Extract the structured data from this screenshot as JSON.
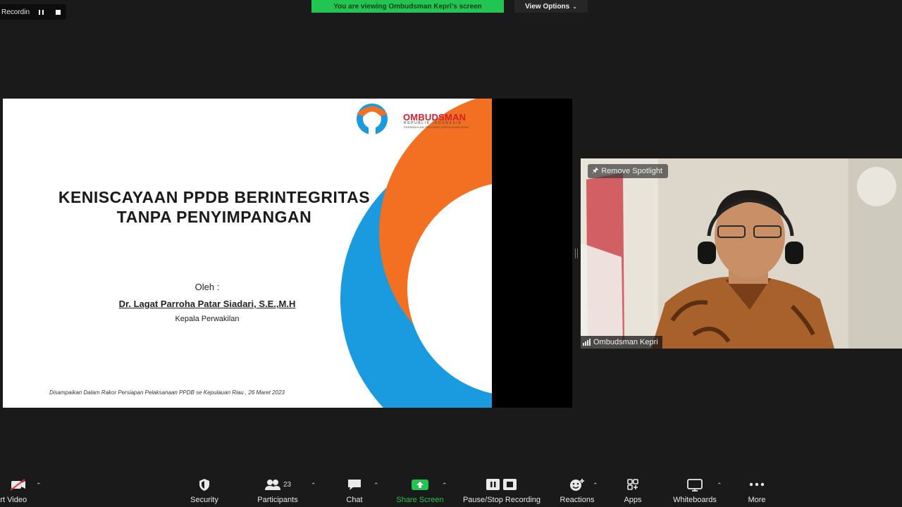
{
  "top_bar": {
    "recording_text": "Recording...",
    "view_banner": "You are viewing Ombudsman Kepri's screen",
    "view_options": "View Options",
    "view_options_icon": "chevron-down-icon"
  },
  "slide": {
    "logo_name": "OMBUDSMAN",
    "logo_subtitle": "REPUBLIK INDONESIA",
    "logo_unit": "PERWAKILAN PROVINSI KEPULAUAN RIAU",
    "title_line1": "KENISCAYAAN PPDB BERINTEGRITAS",
    "title_line2": "TANPA PENYIMPANGAN",
    "by_label": "Oleh :",
    "presenter": "Dr. Lagat Parroha Patar Siadari, S.E.,M.H",
    "role": "Kepala Perwakilan",
    "footer": "Disampaikan Dalam Rakor Persiapan Pelaksanaan PPDB  se Kepulauan Riau ,  26 Maret 2023",
    "colors": {
      "blue": "#1a9be0",
      "orange": "#f36f21",
      "red": "#d0202f"
    }
  },
  "video": {
    "spotlight_button": "Remove Spotlight",
    "participant_name": "Ombudsman Kepri"
  },
  "toolbar": {
    "start_video": "Start Video",
    "security": "Security",
    "participants": "Participants",
    "participants_count": "23",
    "chat": "Chat",
    "share_screen": "Share Screen",
    "recording": "Pause/Stop Recording",
    "reactions": "Reactions",
    "apps": "Apps",
    "whiteboards": "Whiteboards",
    "more": "More",
    "accent_green": "#23c552"
  }
}
